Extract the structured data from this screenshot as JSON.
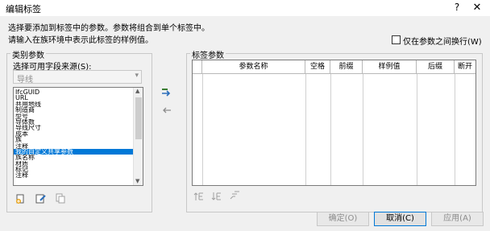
{
  "window": {
    "title": "编辑标签",
    "help_label": "?",
    "close_label": "✕"
  },
  "description": {
    "line1": "选择要添加到标签中的参数。参数将组合到单个标签中。",
    "line2": "请输入在族环境中表示此标签的样例值。"
  },
  "wrap_option": {
    "label": "仅在参数之间换行(W)",
    "checked": false
  },
  "category_params": {
    "group_label": "类别参数",
    "source_label": "选择可用字段来源(S):",
    "source_value": "导线",
    "items": [
      "IfcGUID",
      "URL",
      "共用地线",
      "制造商",
      "型号",
      "导体数",
      "导线尺寸",
      "成本",
      "族",
      "注释",
      "我的自定义共享参数",
      "族名称",
      "材质",
      "标记",
      "注释"
    ],
    "selected_index": 10
  },
  "label_params": {
    "group_label": "标签参数",
    "columns": [
      "参数名称",
      "空格",
      "前缀",
      "样例值",
      "后缀",
      "断开"
    ]
  },
  "buttons": {
    "ok": "确定(O)",
    "cancel": "取消(C)",
    "apply": "应用(A)"
  },
  "icons": {
    "add": "add-parameter-icon",
    "remove": "remove-parameter-icon",
    "new_param": "new-parameter-icon",
    "edit_param": "edit-parameter-icon",
    "shared_param": "shared-parameter-icon",
    "move_up": "move-up-icon",
    "move_down": "move-down-icon",
    "sort": "sort-icon"
  }
}
